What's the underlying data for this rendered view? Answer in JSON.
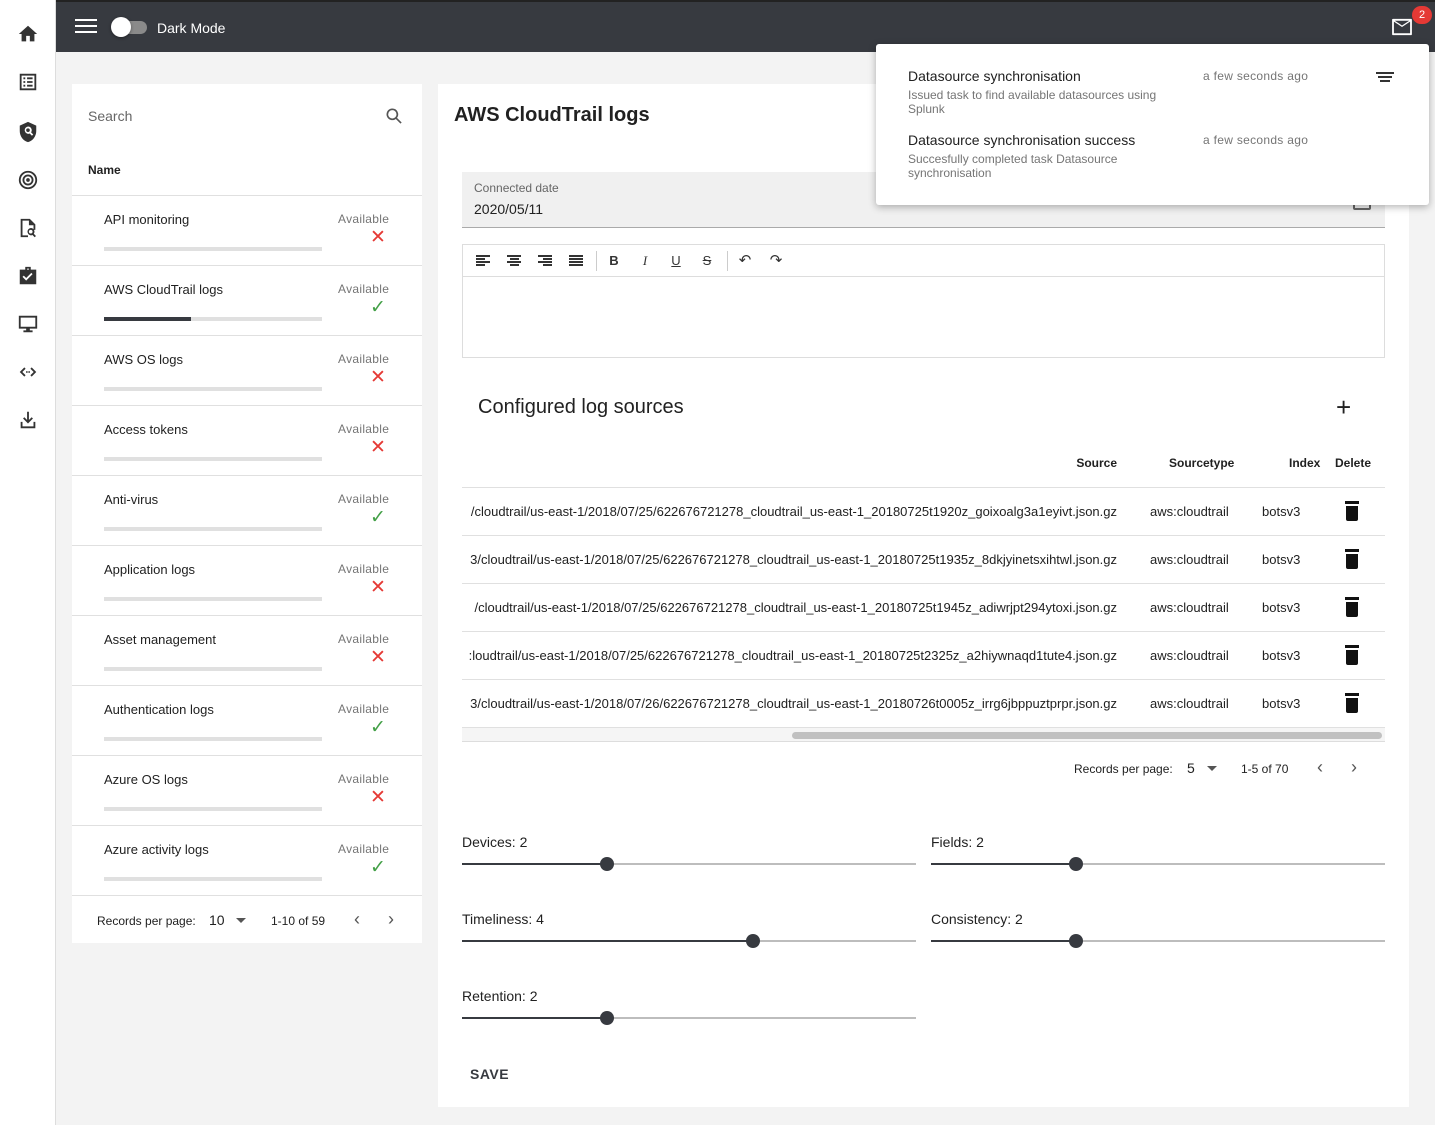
{
  "topbar": {
    "dark_mode_label": "Dark Mode",
    "dark_mode_on": false,
    "mail_badge": "2"
  },
  "rail": {
    "icons": [
      "home-icon",
      "list-icon",
      "shield-search-icon",
      "target-icon",
      "file-search-icon",
      "briefcase-check-icon",
      "monitor-icon",
      "code-arrows-icon",
      "download-icon"
    ]
  },
  "datasources": {
    "search_placeholder": "Search",
    "column_name": "Name",
    "items": [
      {
        "name": "API monitoring",
        "availability": "Available",
        "available": false,
        "progress": 0
      },
      {
        "name": "AWS CloudTrail logs",
        "availability": "Available",
        "available": true,
        "progress": 0.4
      },
      {
        "name": "AWS OS logs",
        "availability": "Available",
        "available": false,
        "progress": 0
      },
      {
        "name": "Access tokens",
        "availability": "Available",
        "available": false,
        "progress": 0
      },
      {
        "name": "Anti-virus",
        "availability": "Available",
        "available": true,
        "progress": 0
      },
      {
        "name": "Application logs",
        "availability": "Available",
        "available": false,
        "progress": 0
      },
      {
        "name": "Asset management",
        "availability": "Available",
        "available": false,
        "progress": 0
      },
      {
        "name": "Authentication logs",
        "availability": "Available",
        "available": true,
        "progress": 0
      },
      {
        "name": "Azure OS logs",
        "availability": "Available",
        "available": false,
        "progress": 0
      },
      {
        "name": "Azure activity logs",
        "availability": "Available",
        "available": true,
        "progress": 0
      }
    ],
    "footer": {
      "rpp_label": "Records per page:",
      "rpp_value": "10",
      "range": "1-10 of 59"
    }
  },
  "detail": {
    "title": "AWS CloudTrail logs",
    "connected_label": "Connected date",
    "connected_value": "2020/05/11",
    "log_sources_title": "Configured log sources",
    "columns": {
      "source": "Source",
      "sourcetype": "Sourcetype",
      "index": "Index",
      "delete": "Delete"
    },
    "rows": [
      {
        "source": "/cloudtrail/us-east-1/2018/07/25/622676721278_cloudtrail_us-east-1_20180725t1920z_goixoalg3a1eyivt.json.gz",
        "sourcetype": "aws:cloudtrail",
        "index": "botsv3"
      },
      {
        "source": "3/cloudtrail/us-east-1/2018/07/25/622676721278_cloudtrail_us-east-1_20180725t1935z_8dkjyinetsxihtwl.json.gz",
        "sourcetype": "aws:cloudtrail",
        "index": "botsv3"
      },
      {
        "source": "/cloudtrail/us-east-1/2018/07/25/622676721278_cloudtrail_us-east-1_20180725t1945z_adiwrjpt294ytoxi.json.gz",
        "sourcetype": "aws:cloudtrail",
        "index": "botsv3"
      },
      {
        "source": ":loudtrail/us-east-1/2018/07/25/622676721278_cloudtrail_us-east-1_20180725t2325z_a2hiywnaqd1tute4.json.gz",
        "sourcetype": "aws:cloudtrail",
        "index": "botsv3"
      },
      {
        "source": "3/cloudtrail/us-east-1/2018/07/26/622676721278_cloudtrail_us-east-1_20180726t0005z_irrg6jbppuztprpr.json.gz",
        "sourcetype": "aws:cloudtrail",
        "index": "botsv3"
      }
    ],
    "table_footer": {
      "rpp_label": "Records per page:",
      "rpp_value": "5",
      "range": "1-5 of 70"
    },
    "sliders": [
      {
        "label": "Devices: 2",
        "value": 2,
        "max": 5
      },
      {
        "label": "Fields: 2",
        "value": 2,
        "max": 5
      },
      {
        "label": "Timeliness: 4",
        "value": 4,
        "max": 5
      },
      {
        "label": "Consistency: 2",
        "value": 2,
        "max": 5
      },
      {
        "label": "Retention: 2",
        "value": 2,
        "max": 5
      }
    ],
    "save_label": "SAVE"
  },
  "notifications": [
    {
      "title": "Datasource synchronisation",
      "body": "Issued task to find available datasources using Splunk",
      "time": "a few seconds ago"
    },
    {
      "title": "Datasource synchronisation success",
      "body": "Succesfully completed task Datasource synchronisation",
      "time": "a few seconds ago"
    }
  ],
  "colors": {
    "accent": "#373a40",
    "ok": "#43a047",
    "error": "#e53935"
  }
}
